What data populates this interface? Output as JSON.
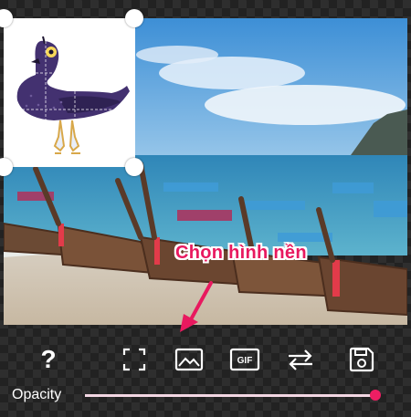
{
  "annotation": {
    "text": "Chọn hình nền",
    "color": "#e8195f"
  },
  "sticker": {
    "description_icon": "pigeon-sticker"
  },
  "toolbar": {
    "help_label": "?",
    "tools": [
      {
        "name": "help",
        "icon": "question-mark-icon"
      },
      {
        "name": "crop",
        "icon": "expand-frame-icon"
      },
      {
        "name": "background-image",
        "icon": "image-icon"
      },
      {
        "name": "gif",
        "icon": "gif-icon"
      },
      {
        "name": "swap",
        "icon": "swap-arrows-icon"
      },
      {
        "name": "save",
        "icon": "save-icon"
      }
    ],
    "gif_label": "GIF"
  },
  "opacity": {
    "label": "Opacity",
    "value": 1.0,
    "accent": "#ee1e63"
  }
}
